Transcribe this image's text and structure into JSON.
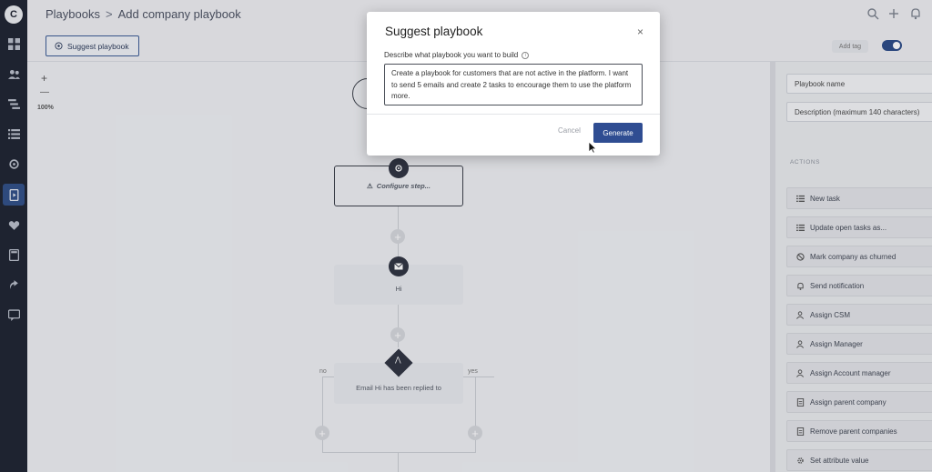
{
  "breadcrumb": {
    "parent": "Playbooks",
    "separator": ">",
    "current": "Add company playbook"
  },
  "toolbar": {
    "suggest_label": "Suggest playbook",
    "add_tag": "Add tag"
  },
  "canvas": {
    "zoom_in": "+",
    "zoom_out": "—",
    "zoom_level": "100%",
    "configure_step": "Configure step...",
    "email_node": "Hi",
    "condition_node": "Email Hi has been replied to",
    "branch_no": "no",
    "branch_yes": "yes",
    "add_symbol": "+"
  },
  "right_panel": {
    "name_placeholder": "Playbook name",
    "description_placeholder": "Description (maximum 140 characters)",
    "actions_label": "ACTIONS",
    "actions": [
      {
        "label": "New task",
        "icon": "list-icon"
      },
      {
        "label": "Update open tasks as...",
        "icon": "list-icon"
      },
      {
        "label": "Mark company as churned",
        "icon": "ban-icon"
      },
      {
        "label": "Send notification",
        "icon": "bell-icon"
      },
      {
        "label": "Assign CSM",
        "icon": "user-icon"
      },
      {
        "label": "Assign Manager",
        "icon": "user-icon"
      },
      {
        "label": "Assign Account manager",
        "icon": "user-icon"
      },
      {
        "label": "Assign parent company",
        "icon": "doc-icon"
      },
      {
        "label": "Remove parent companies",
        "icon": "doc-icon"
      },
      {
        "label": "Set attribute value",
        "icon": "gear-icon"
      }
    ]
  },
  "modal": {
    "title": "Suggest playbook",
    "close": "×",
    "label": "Describe what playbook you want to build",
    "info": "i",
    "text": "Create a playbook for customers that are not active in the platform. I want to send 5 emails and create 2 tasks to encourage them to use the platform more.",
    "cancel": "Cancel",
    "generate": "Generate"
  },
  "colors": {
    "nav": "#1d2330",
    "accent": "#2f4d92",
    "nav_active": "#2f4f86"
  }
}
